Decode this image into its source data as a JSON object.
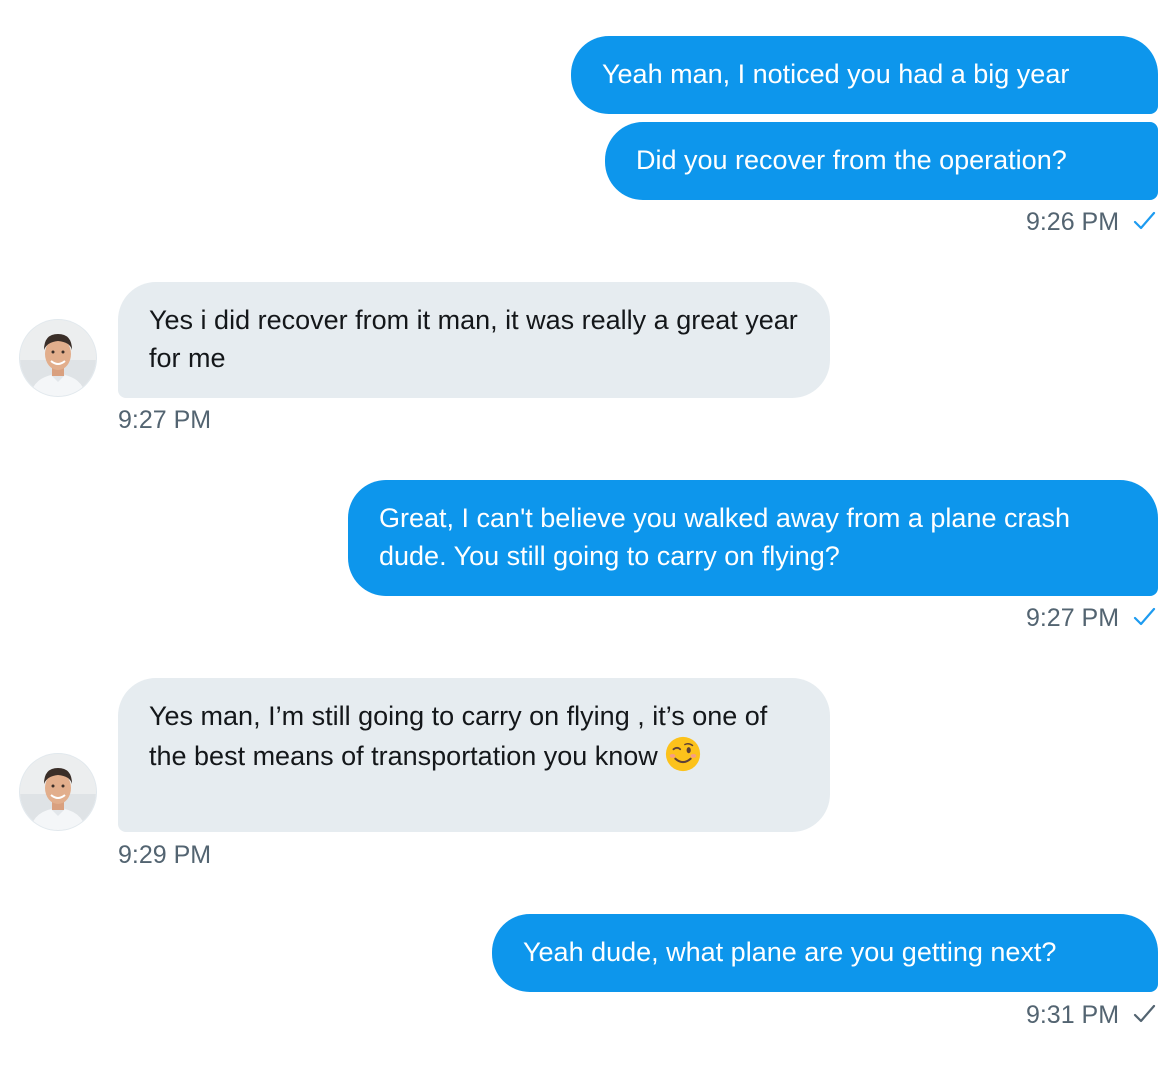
{
  "messages": [
    {
      "side": "sent",
      "text": "Yeah man, I noticed you had a big year"
    },
    {
      "side": "sent",
      "text": "Did you recover from the operation?",
      "time": "9:26 PM"
    },
    {
      "side": "received",
      "text": "Yes i did recover from it man, it was really a great year for me",
      "time": "9:27 PM"
    },
    {
      "side": "sent",
      "text": "Great, I can't believe you walked away from a plane crash dude. You still going to carry on flying?",
      "time": "9:27 PM"
    },
    {
      "side": "received",
      "text": "Yes man, I’m still going to carry on flying , it’s one of the best means of transportation you know",
      "emoji": "winking-face",
      "time": "9:29 PM"
    },
    {
      "side": "sent",
      "text": "Yeah dude, what plane are you getting next?",
      "time": "9:31 PM"
    }
  ],
  "colors": {
    "sent_bubble": "#0d96ec",
    "received_bubble": "#e6ecf0",
    "read_check": "#1d9bf0",
    "sent_check": "#536471",
    "timestamp": "#536471"
  },
  "icons": {
    "read_receipt": "checkmark-icon",
    "avatar": "user-avatar-photo"
  }
}
